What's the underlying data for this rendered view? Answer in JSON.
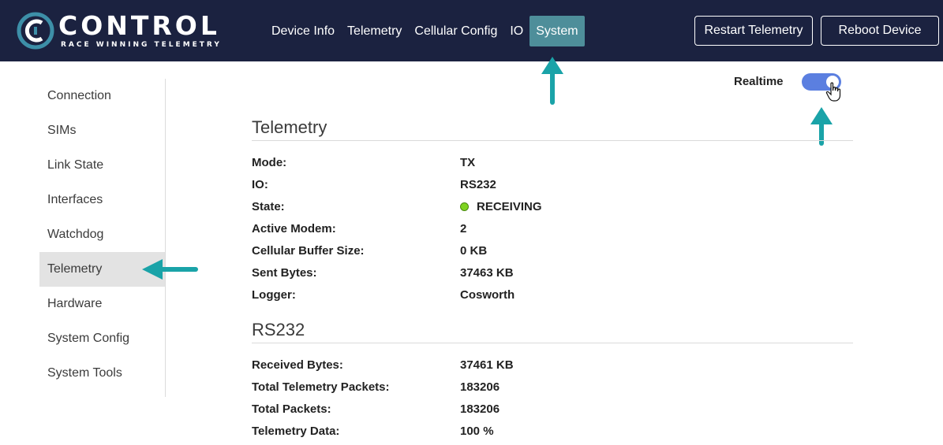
{
  "brand": {
    "name": "CONTROL",
    "tagline": "RACE WINNING TELEMETRY"
  },
  "nav": {
    "items": [
      {
        "label": "Device Info"
      },
      {
        "label": "Telemetry"
      },
      {
        "label": "Cellular Config"
      },
      {
        "label": "IO"
      },
      {
        "label": "System"
      }
    ],
    "active": "System"
  },
  "header_buttons": {
    "restart": "Restart Telemetry",
    "reboot": "Reboot Device"
  },
  "sidebar": {
    "items": [
      {
        "label": "Connection"
      },
      {
        "label": "SIMs"
      },
      {
        "label": "Link State"
      },
      {
        "label": "Interfaces"
      },
      {
        "label": "Watchdog"
      },
      {
        "label": "Telemetry"
      },
      {
        "label": "Hardware"
      },
      {
        "label": "System Config"
      },
      {
        "label": "System Tools"
      }
    ],
    "active": "Telemetry"
  },
  "realtime": {
    "label": "Realtime",
    "enabled": true
  },
  "telemetry": {
    "title": "Telemetry",
    "rows": [
      {
        "key": "Mode:",
        "value": "TX"
      },
      {
        "key": "IO:",
        "value": "RS232"
      },
      {
        "key": "State:",
        "value": "RECEIVING"
      },
      {
        "key": "Active Modem:",
        "value": "2"
      },
      {
        "key": "Cellular Buffer Size:",
        "value": "0 KB"
      },
      {
        "key": "Sent Bytes:",
        "value": "37463 KB"
      },
      {
        "key": "Logger:",
        "value": "Cosworth"
      }
    ]
  },
  "rs232": {
    "title": "RS232",
    "rows": [
      {
        "key": "Received Bytes:",
        "value": "37461 KB"
      },
      {
        "key": "Total Telemetry Packets:",
        "value": "183206"
      },
      {
        "key": "Total Packets:",
        "value": "183206"
      },
      {
        "key": "Telemetry Data:",
        "value": "100 %"
      }
    ]
  },
  "colors": {
    "header_bg": "#1b2240",
    "nav_active": "#4e8e9a",
    "toggle_on": "#5b7fe0",
    "state_ok": "#7ed321",
    "annotation_arrow": "#1aa3a8"
  }
}
